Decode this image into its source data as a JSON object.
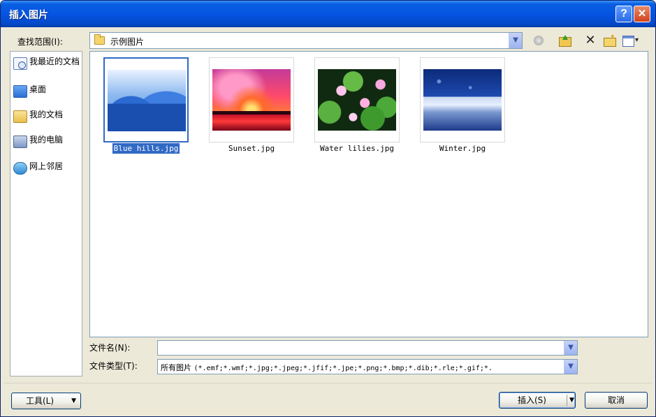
{
  "window": {
    "title": "插入图片",
    "help_glyph": "?",
    "close_glyph": "✕"
  },
  "lookin": {
    "label": "查找范围(I):",
    "value": "示例图片"
  },
  "toolbar": {
    "delete_glyph": "✕",
    "icons": [
      "back-icon",
      "up-folder-icon",
      "delete-icon",
      "new-folder-icon",
      "views-menu-icon"
    ]
  },
  "places": [
    {
      "label": "我最近的文档",
      "icon": "recent-documents-icon"
    },
    {
      "label": "桌面",
      "icon": "desktop-icon"
    },
    {
      "label": "我的文档",
      "icon": "my-documents-icon"
    },
    {
      "label": "我的电脑",
      "icon": "my-computer-icon"
    },
    {
      "label": "网上邻居",
      "icon": "network-places-icon"
    }
  ],
  "files": [
    {
      "name": "Blue hills.jpg",
      "selected": true
    },
    {
      "name": "Sunset.jpg",
      "selected": false
    },
    {
      "name": "Water lilies.jpg",
      "selected": false
    },
    {
      "name": "Winter.jpg",
      "selected": false
    }
  ],
  "filename": {
    "label": "文件名(N):",
    "value": ""
  },
  "filetype": {
    "label": "文件类型(T):",
    "prefix": "所有图片",
    "patterns": "(*.emf;*.wmf;*.jpg;*.jpeg;*.jfif;*.jpe;*.png;*.bmp;*.dib;*.rle;*.gif;*."
  },
  "buttons": {
    "tools": "工具(L)",
    "insert": "插入(S)",
    "cancel": "取消"
  },
  "colors": {
    "titlebar": "#0554e3",
    "selection": "#316ac5",
    "dialog_bg": "#ece9d8"
  }
}
